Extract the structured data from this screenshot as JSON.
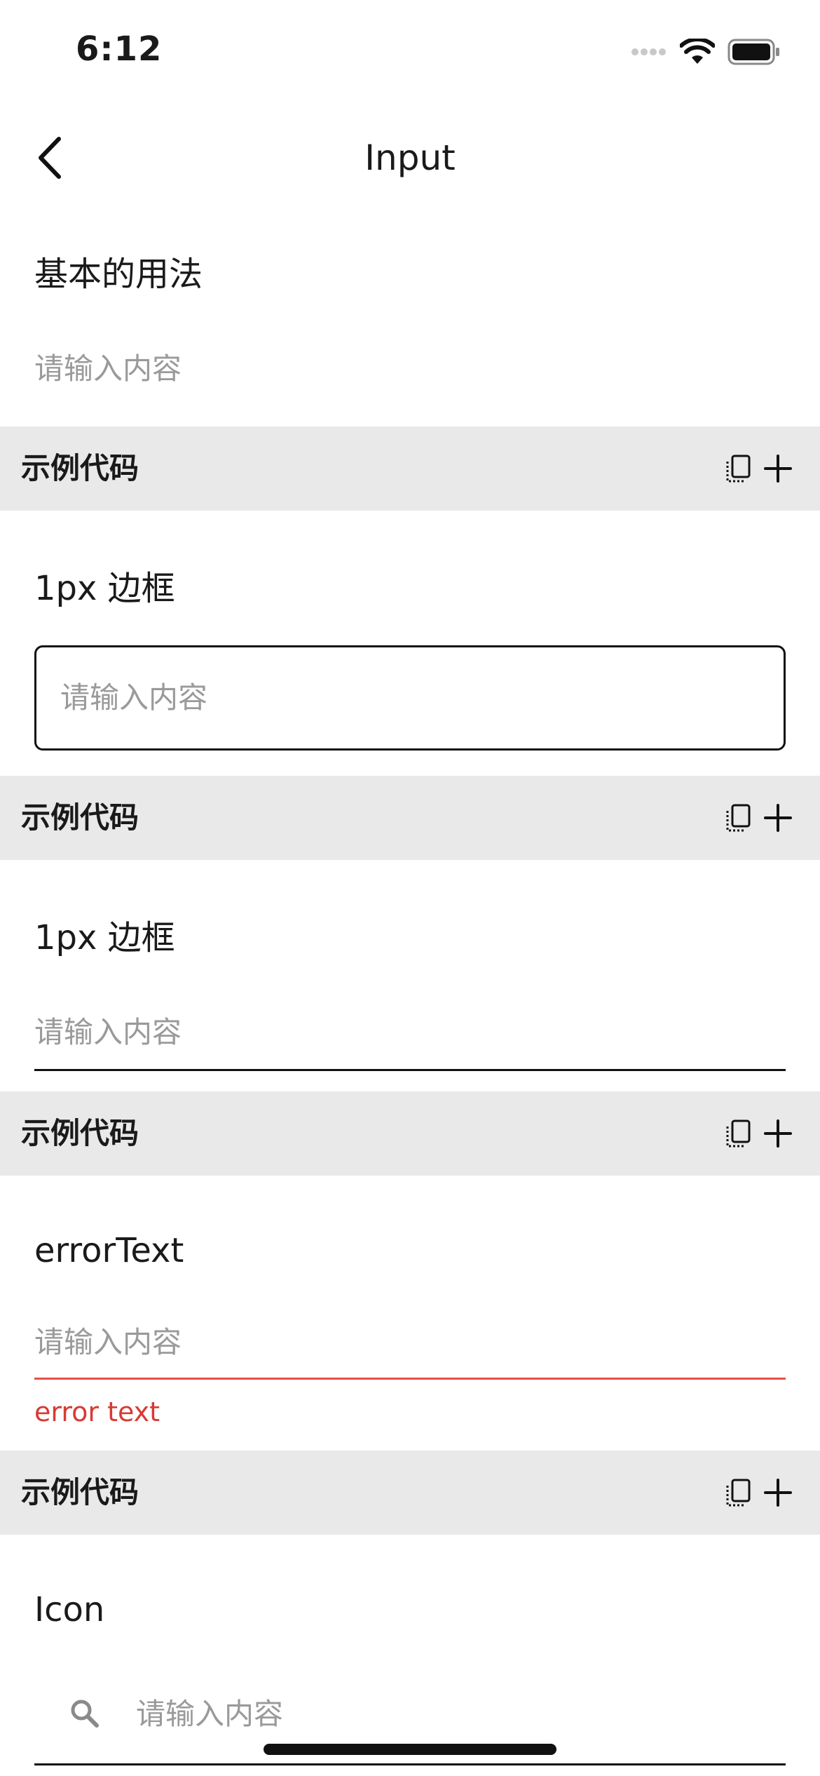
{
  "status": {
    "time": "6:12"
  },
  "nav": {
    "title": "Input"
  },
  "sections": [
    {
      "title": "基本的用法",
      "placeholder": "请输入内容",
      "code_label": "示例代码"
    },
    {
      "title": "1px 边框",
      "placeholder": "请输入内容",
      "code_label": "示例代码"
    },
    {
      "title": "1px 边框",
      "placeholder": "请输入内容",
      "code_label": "示例代码"
    },
    {
      "title": "errorText",
      "placeholder": "请输入内容",
      "error": "error text",
      "code_label": "示例代码"
    },
    {
      "title": "Icon",
      "placeholder": "请输入内容"
    }
  ],
  "colors": {
    "code_bar_bg": "#e9e9e9",
    "error": "#d83a34",
    "placeholder": "#9a9a9a"
  },
  "icons": {
    "back": "chevron-left-icon",
    "copy": "copy-icon",
    "add": "plus-icon",
    "search": "search-icon"
  }
}
